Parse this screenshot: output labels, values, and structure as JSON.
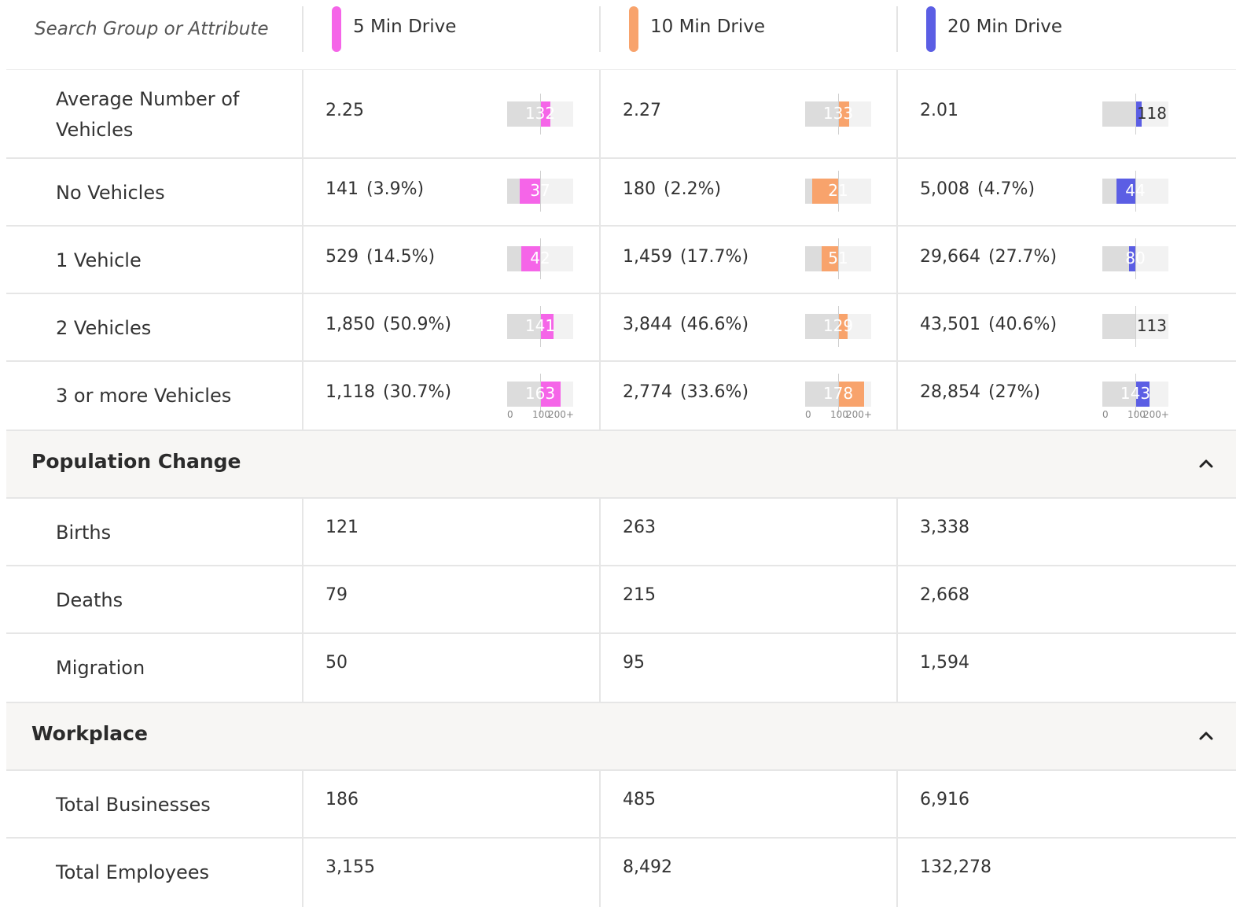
{
  "search": {
    "placeholder": "Search Group or Attribute"
  },
  "columns": [
    {
      "label": "5 Min Drive",
      "color": "#f565e8"
    },
    {
      "label": "10 Min Drive",
      "color": "#f8a36c"
    },
    {
      "label": "20 Min Drive",
      "color": "#5b5ee4"
    }
  ],
  "index_axis": {
    "ticks": [
      "0",
      "100",
      "200+"
    ],
    "max": 200
  },
  "vehicles": {
    "rows": [
      {
        "label": "Average Number of Vehicles",
        "cells": [
          {
            "value": "2.25",
            "index": 132
          },
          {
            "value": "2.27",
            "index": 133
          },
          {
            "value": "2.01",
            "index": 118
          }
        ]
      },
      {
        "label": "No Vehicles",
        "cells": [
          {
            "value": "141",
            "pct": "(3.9%)",
            "index": 37
          },
          {
            "value": "180",
            "pct": "(2.2%)",
            "index": 21
          },
          {
            "value": "5,008",
            "pct": "(4.7%)",
            "index": 44
          }
        ]
      },
      {
        "label": "1 Vehicle",
        "cells": [
          {
            "value": "529",
            "pct": "(14.5%)",
            "index": 42
          },
          {
            "value": "1,459",
            "pct": "(17.7%)",
            "index": 51
          },
          {
            "value": "29,664",
            "pct": "(27.7%)",
            "index": 80
          }
        ]
      },
      {
        "label": "2 Vehicles",
        "cells": [
          {
            "value": "1,850",
            "pct": "(50.9%)",
            "index": 141
          },
          {
            "value": "3,844",
            "pct": "(46.6%)",
            "index": 129
          },
          {
            "value": "43,501",
            "pct": "(40.6%)",
            "index": 113
          }
        ]
      },
      {
        "label": "3 or more Vehicles",
        "cells": [
          {
            "value": "1,118",
            "pct": "(30.7%)",
            "index": 163
          },
          {
            "value": "2,774",
            "pct": "(33.6%)",
            "index": 178
          },
          {
            "value": "28,854",
            "pct": "(27%)",
            "index": 143
          }
        ]
      }
    ]
  },
  "population_change": {
    "title": "Population Change",
    "rows": [
      {
        "label": "Births",
        "cells": [
          "121",
          "263",
          "3,338"
        ]
      },
      {
        "label": "Deaths",
        "cells": [
          "79",
          "215",
          "2,668"
        ]
      },
      {
        "label": "Migration",
        "cells": [
          "50",
          "95",
          "1,594"
        ]
      }
    ]
  },
  "workplace": {
    "title": "Workplace",
    "rows": [
      {
        "label": "Total Businesses",
        "cells": [
          "186",
          "485",
          "6,916"
        ]
      },
      {
        "label": "Total Employees",
        "cells": [
          "3,155",
          "8,492",
          "132,278"
        ]
      }
    ]
  }
}
